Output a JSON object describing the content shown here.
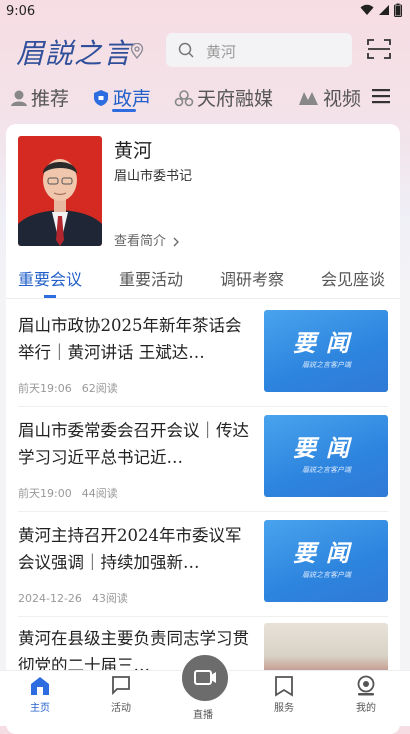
{
  "status_bar": {
    "time": "9:06"
  },
  "header": {
    "logo_text": "眉説之言",
    "search_placeholder": "黄河"
  },
  "channels": [
    {
      "label": "推荐",
      "active": false
    },
    {
      "label": "政声",
      "active": true
    },
    {
      "label": "天府融媒",
      "active": false
    },
    {
      "label": "视频",
      "active": false
    }
  ],
  "profile": {
    "name": "黄河",
    "title": "眉山市委书记",
    "more_link": "查看简介"
  },
  "sub_tabs": [
    {
      "label": "重要会议",
      "active": true
    },
    {
      "label": "重要活动",
      "active": false
    },
    {
      "label": "调研考察",
      "active": false
    },
    {
      "label": "会见座谈",
      "active": false
    }
  ],
  "news": [
    {
      "title": "眉山市政协2025年新年茶话会举行｜黄河讲话 王斌达…",
      "time": "前天19:06",
      "reads": "62阅读",
      "thumb_text": "要闻",
      "thumb_sub": "眉説之言客户端"
    },
    {
      "title": "眉山市委常委会召开会议｜传达学习习近平总书记近…",
      "time": "前天19:00",
      "reads": "44阅读",
      "thumb_text": "要闻",
      "thumb_sub": "眉説之言客户端"
    },
    {
      "title": "黄河主持召开2024年市委议军会议强调｜持续加强新…",
      "time": "2024-12-26",
      "reads": "43阅读",
      "thumb_text": "要闻",
      "thumb_sub": "眉説之言客户端"
    },
    {
      "title": "黄河在县级主要负责同志学习贯彻党的二十届三…",
      "time": "",
      "reads": "",
      "thumb_text": "",
      "thumb_sub": ""
    }
  ],
  "tab_bar": [
    {
      "label": "主页",
      "icon": "home-icon",
      "active": true
    },
    {
      "label": "活动",
      "icon": "flag-icon",
      "active": false
    },
    {
      "label": "直播",
      "icon": "video-camera-icon",
      "active": false
    },
    {
      "label": "服务",
      "icon": "bookmark-icon",
      "active": false
    },
    {
      "label": "我的",
      "icon": "user-icon",
      "active": false
    }
  ],
  "colors": {
    "accent": "#2360c9",
    "brand_logo": "#2f4f9a",
    "thumb_blue": "#2d84de"
  }
}
